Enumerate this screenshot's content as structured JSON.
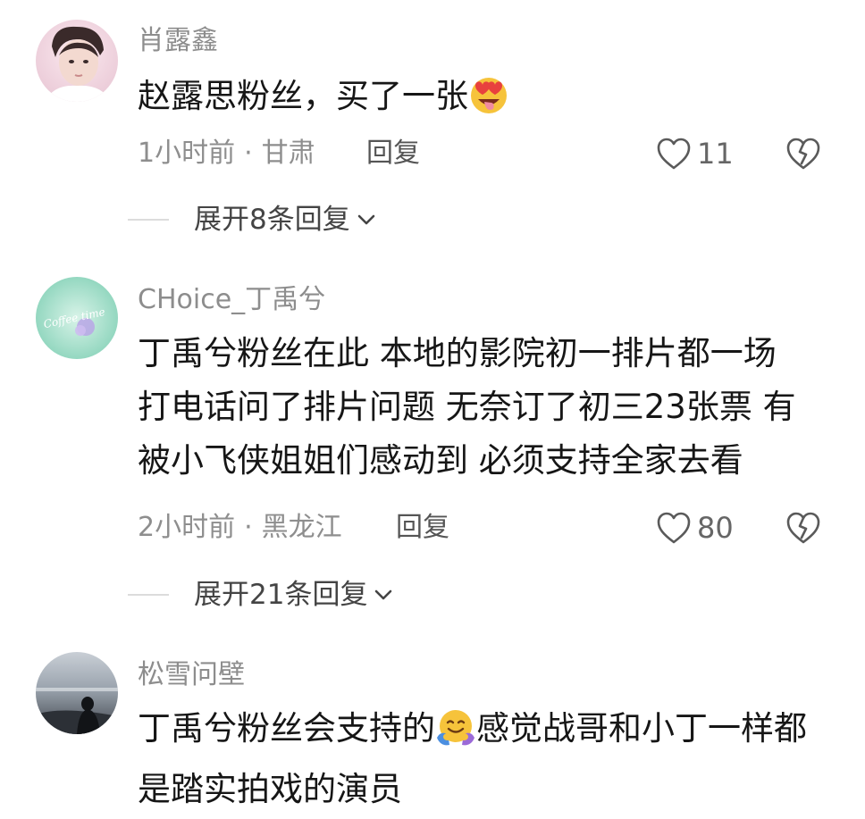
{
  "comments": [
    {
      "username": "肖露鑫",
      "content_lines": [
        "赵露思粉丝，买了一张"
      ],
      "time": "1小时前",
      "location": "甘肃",
      "reply_label": "回复",
      "likes": "11",
      "expand_label": "展开8条回复"
    },
    {
      "username": "CHoice_丁禹兮",
      "content_lines": [
        "丁禹兮粉丝在此 本地的影院初一排片都一场",
        "打电话问了排片问题 无奈订了初三23张票 有",
        "被小飞侠姐姐们感动到 必须支持全家去看"
      ],
      "time": "2小时前",
      "location": "黑龙江",
      "reply_label": "回复",
      "likes": "80",
      "expand_label": "展开21条回复",
      "avatar_text": "Coffee time"
    },
    {
      "username": "松雪问壁",
      "content_part1": "丁禹兮粉丝会支持的",
      "content_part2": "感觉战哥和小丁一样都",
      "content_line2": "是踏实拍戏的演员"
    }
  ],
  "separator": "·",
  "icons": {
    "like": "heart-outline-icon",
    "dislike": "broken-heart-icon",
    "expand": "chevron-down-icon",
    "emoji1": "heart-eyes-tongue-emoji",
    "emoji2": "hugging-face-emoji"
  },
  "colors": {
    "text": "#161616",
    "muted": "#8d8d8d",
    "divider": "#dcdcdc"
  }
}
